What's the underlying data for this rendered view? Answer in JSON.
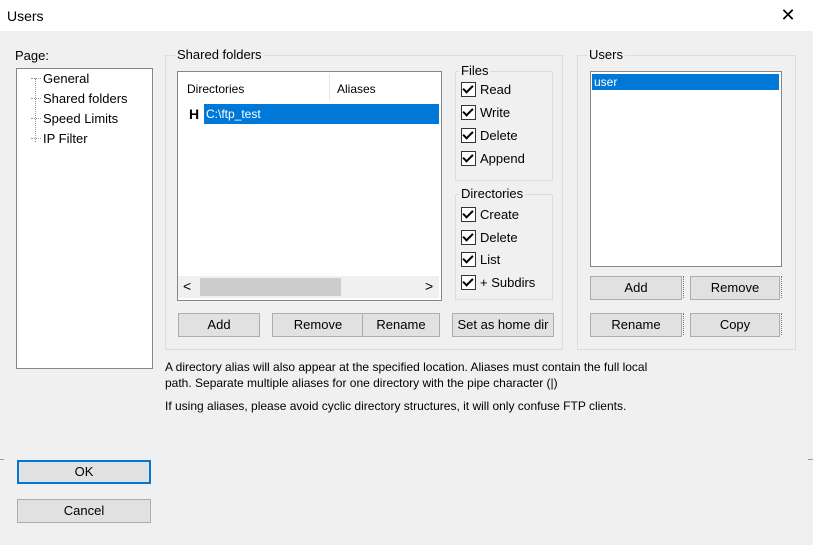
{
  "window": {
    "title": "Users",
    "close_glyph": "✕"
  },
  "page_panel": {
    "label": "Page:",
    "items": [
      "General",
      "Shared folders",
      "Speed Limits",
      "IP Filter"
    ]
  },
  "shared_folders": {
    "group_label": "Shared folders",
    "columns": [
      "Directories",
      "Aliases"
    ],
    "rows": [
      {
        "marker": "H",
        "directory": "C:\\ftp_test",
        "alias": ""
      }
    ],
    "scroll_left": "<",
    "scroll_right": ">",
    "buttons": {
      "add": "Add",
      "remove": "Remove",
      "rename": "Rename",
      "set_home": "Set as home dir"
    }
  },
  "files_group": {
    "label": "Files",
    "options": [
      {
        "label": "Read",
        "checked": true
      },
      {
        "label": "Write",
        "checked": true
      },
      {
        "label": "Delete",
        "checked": true
      },
      {
        "label": "Append",
        "checked": true
      }
    ]
  },
  "directories_group": {
    "label": "Directories",
    "options": [
      {
        "label": "Create",
        "checked": true
      },
      {
        "label": "Delete",
        "checked": true
      },
      {
        "label": "List",
        "checked": true
      },
      {
        "label": "+ Subdirs",
        "checked": true
      }
    ]
  },
  "users_group": {
    "label": "Users",
    "items": [
      "user"
    ],
    "buttons": {
      "add": "Add",
      "remove": "Remove",
      "rename": "Rename",
      "copy": "Copy"
    }
  },
  "info": {
    "line1": "A directory alias will also appear at the specified location. Aliases must contain the full local",
    "line2": "path. Separate multiple aliases for one directory with the pipe character (|)",
    "line3": "If using aliases, please avoid cyclic directory structures, it will only confuse FTP clients."
  },
  "footer": {
    "ok": "OK",
    "cancel": "Cancel"
  },
  "colors": {
    "accent": "#0078d7",
    "background": "#f0f0f0"
  }
}
